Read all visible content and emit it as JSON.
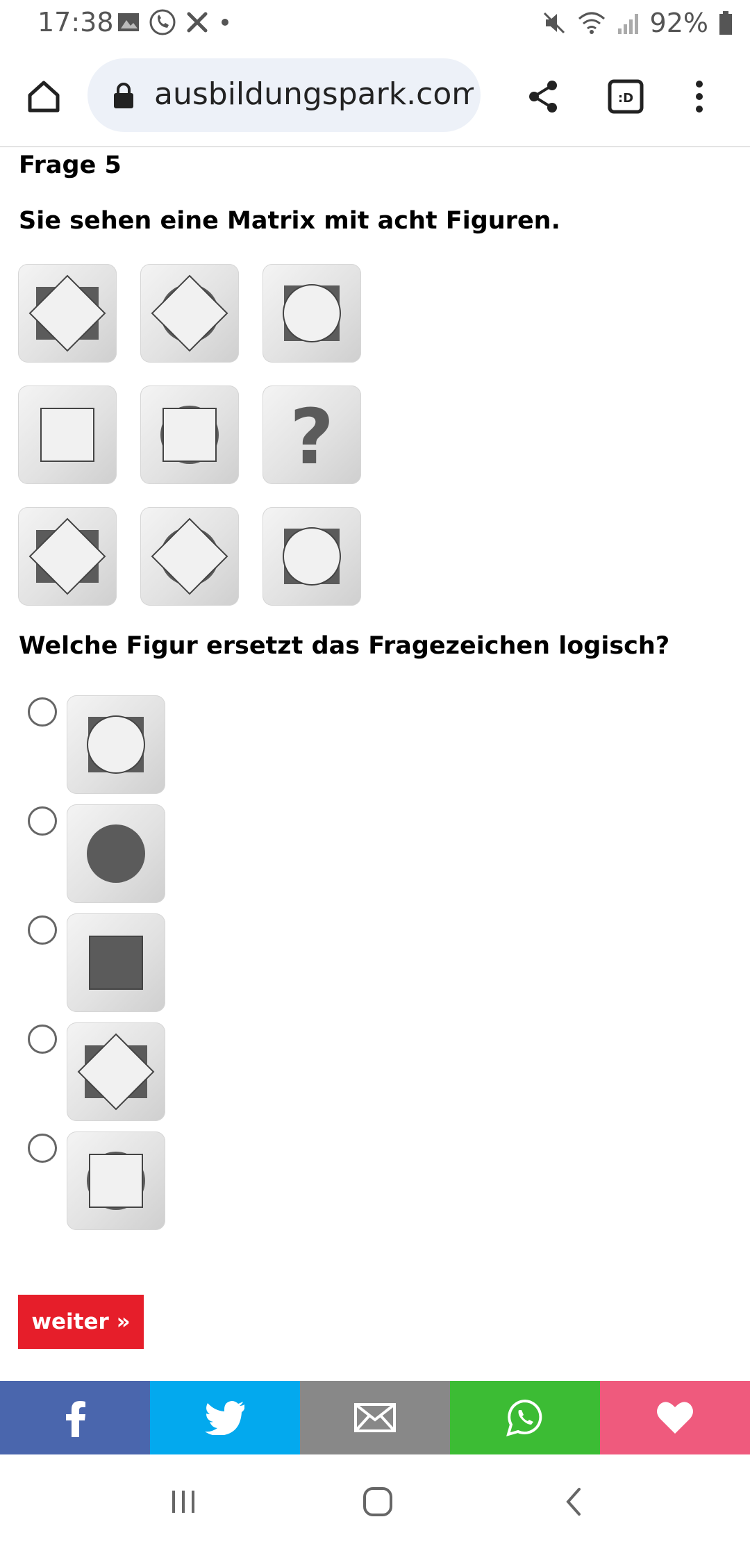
{
  "status_bar": {
    "time": "17:38",
    "battery_percent": "92%",
    "icons_left": [
      "gallery-icon",
      "phone-call-icon",
      "tools-icon",
      "dot-icon"
    ],
    "icons_right": [
      "mute-icon",
      "wifi-icon",
      "signal-icon",
      "battery-icon"
    ]
  },
  "browser": {
    "url": "ausbildungspark.com/",
    "tab_count_label": ":D",
    "icons": [
      "home-icon",
      "lock-icon",
      "share-icon",
      "tabs-icon",
      "more-icon"
    ]
  },
  "quiz": {
    "title": "Frage 5",
    "intro": "Sie sehen eine Matrix mit acht Figuren.",
    "question": "Welche Figur ersetzt das Fragezeichen logisch?",
    "matrix_question_mark": "?",
    "matrix": [
      [
        "diamond-over-dark-square",
        "diamond-over-dark-circle",
        "circle-over-dark-square"
      ],
      [
        "square-plain",
        "square-over-dark-circle",
        "question-mark"
      ],
      [
        "diamond-over-dark-square",
        "diamond-over-dark-circle",
        "circle-over-dark-square"
      ]
    ],
    "options": [
      {
        "figure": "circle-over-dark-square",
        "selected": false
      },
      {
        "figure": "dark-circle",
        "selected": false
      },
      {
        "figure": "dark-square",
        "selected": false
      },
      {
        "figure": "diamond-over-dark-square",
        "selected": false
      },
      {
        "figure": "square-over-dark-circle",
        "selected": false
      }
    ],
    "next_label": "weiter »"
  },
  "share_bar": {
    "items": [
      {
        "name": "facebook",
        "color": "#4a66ad"
      },
      {
        "name": "twitter",
        "color": "#03a9ee"
      },
      {
        "name": "email",
        "color": "#888888"
      },
      {
        "name": "whatsapp",
        "color": "#3cbc34"
      },
      {
        "name": "favorite",
        "color": "#ef5a7d"
      }
    ]
  },
  "colors": {
    "button_red": "#e61e2a",
    "figure_dark": "#5b5b5b",
    "figure_light": "#f1f1f1",
    "url_bg": "#edf1f8"
  }
}
